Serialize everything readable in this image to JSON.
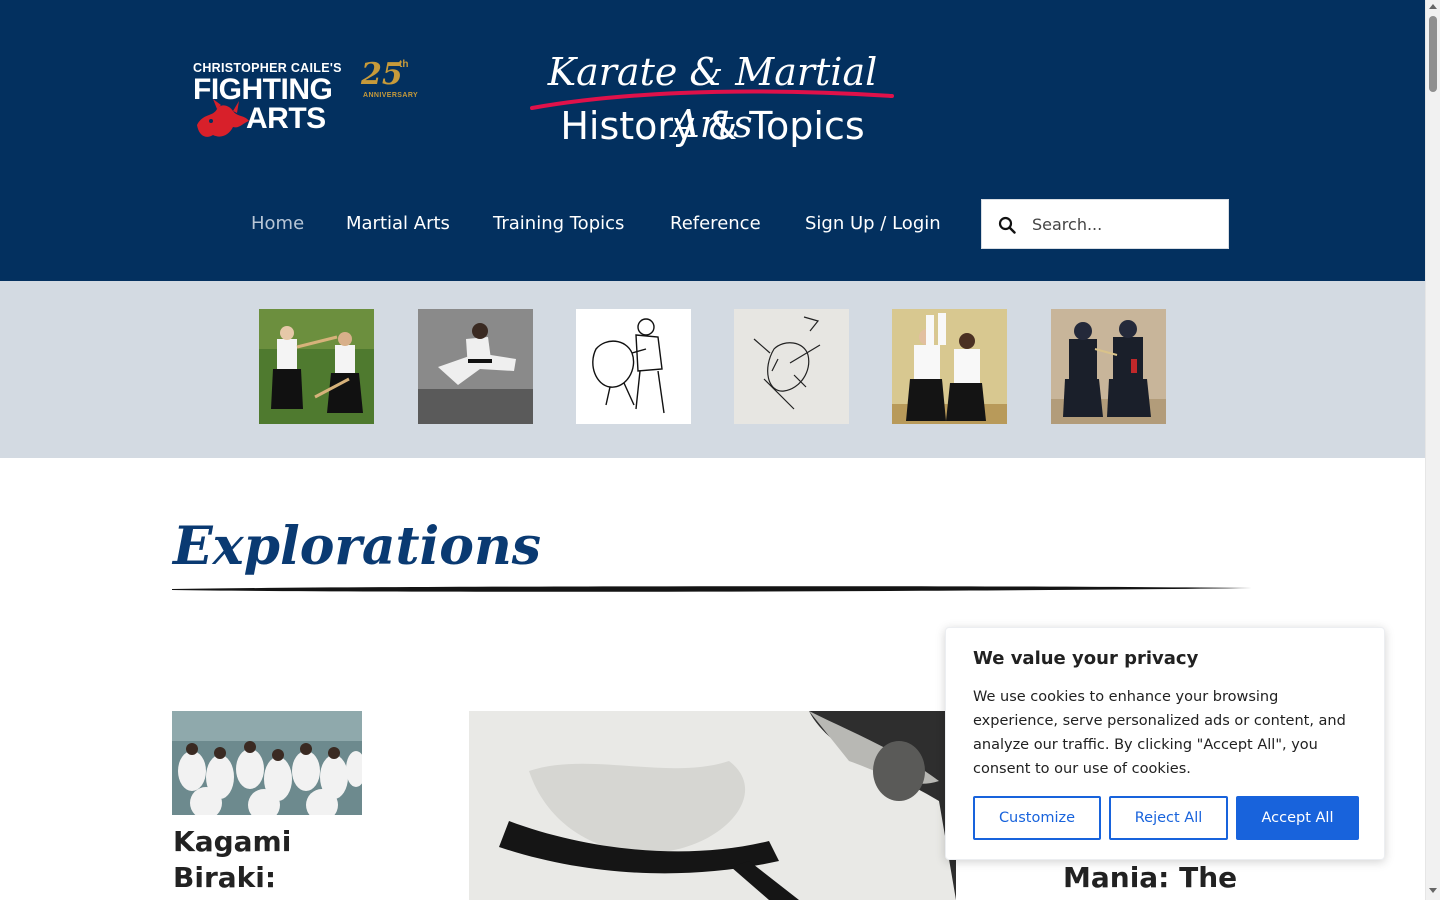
{
  "logo": {
    "line_top": "CHRISTOPHER CAILE'S",
    "line_fighting": "FIGHTING",
    "line_arts": "ARTS",
    "anniversary_number": "25",
    "anniversary_suffix": "th",
    "anniversary_label": "ANNIVERSARY"
  },
  "site_title": {
    "line1": "Karate & Martial Arts",
    "line2": "History & Topics"
  },
  "nav": {
    "items": [
      {
        "label": "Home",
        "active": true
      },
      {
        "label": "Martial Arts",
        "active": false
      },
      {
        "label": "Training Topics",
        "active": false
      },
      {
        "label": "Reference",
        "active": false
      },
      {
        "label": "Sign Up / Login",
        "active": false
      }
    ]
  },
  "search": {
    "placeholder": "Search..."
  },
  "gallery": {
    "thumbnails": [
      {
        "icon": "aikido-staff-photo"
      },
      {
        "icon": "flying-kick-photo"
      },
      {
        "icon": "throw-drawing"
      },
      {
        "icon": "sword-sketch"
      },
      {
        "icon": "aikido-pair-photo"
      },
      {
        "icon": "kendo-photo"
      }
    ]
  },
  "main": {
    "section_heading": "Explorations",
    "cards": [
      {
        "title": "Kagami Biraki:"
      },
      {
        "title": "Mania: The"
      }
    ]
  },
  "cookie_banner": {
    "title": "We value your privacy",
    "body": "We use cookies to enhance your browsing experience, serve personalized ads or content, and analyze our traffic. By clicking \"Accept All\", you consent to our use of cookies.",
    "customize_label": "Customize",
    "reject_label": "Reject All",
    "accept_label": "Accept All"
  },
  "colors": {
    "header_bg": "#03305f",
    "gallery_bg": "#d3dae2",
    "heading_blue": "#0a3a72",
    "accent_red": "#e0114a",
    "button_blue": "#1863dc"
  }
}
